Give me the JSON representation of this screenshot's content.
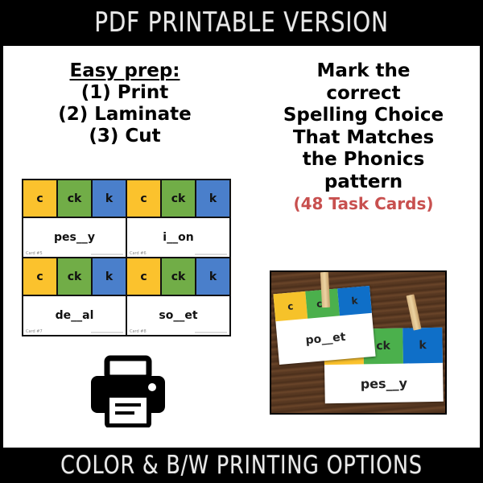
{
  "header": {
    "title": "PDF PRINTABLE VERSION"
  },
  "footer": {
    "title": "COLOR & B/W PRINTING OPTIONS"
  },
  "left": {
    "heading": "Easy prep:",
    "steps": [
      "(1) Print",
      "(2) Laminate",
      "(3) Cut"
    ]
  },
  "right": {
    "lines": [
      "Mark the",
      "correct",
      "Spelling Choice",
      "That Matches",
      "the Phonics",
      "pattern"
    ],
    "count_note": "(48 Task Cards)"
  },
  "task_cards": [
    {
      "choices": [
        "c",
        "ck",
        "k"
      ],
      "word": "pes__y",
      "label": "Card #5"
    },
    {
      "choices": [
        "c",
        "ck",
        "k"
      ],
      "word": "i__on",
      "label": "Card #6"
    },
    {
      "choices": [
        "c",
        "ck",
        "k"
      ],
      "word": "de__al",
      "label": "Card #7"
    },
    {
      "choices": [
        "c",
        "ck",
        "k"
      ],
      "word": "so__et",
      "label": "Card #8"
    }
  ],
  "photo_cards": [
    {
      "choices": [
        "c",
        "ck",
        "k"
      ],
      "word": "po__et"
    },
    {
      "choices": [
        "",
        "ck",
        "k"
      ],
      "word": "pes__y"
    }
  ],
  "icons": {
    "printer": "printer-icon"
  },
  "colors": {
    "c": "#fbc22d",
    "ck": "#71ad47",
    "k": "#4a7fcb",
    "accent_red": "#c8504f"
  }
}
